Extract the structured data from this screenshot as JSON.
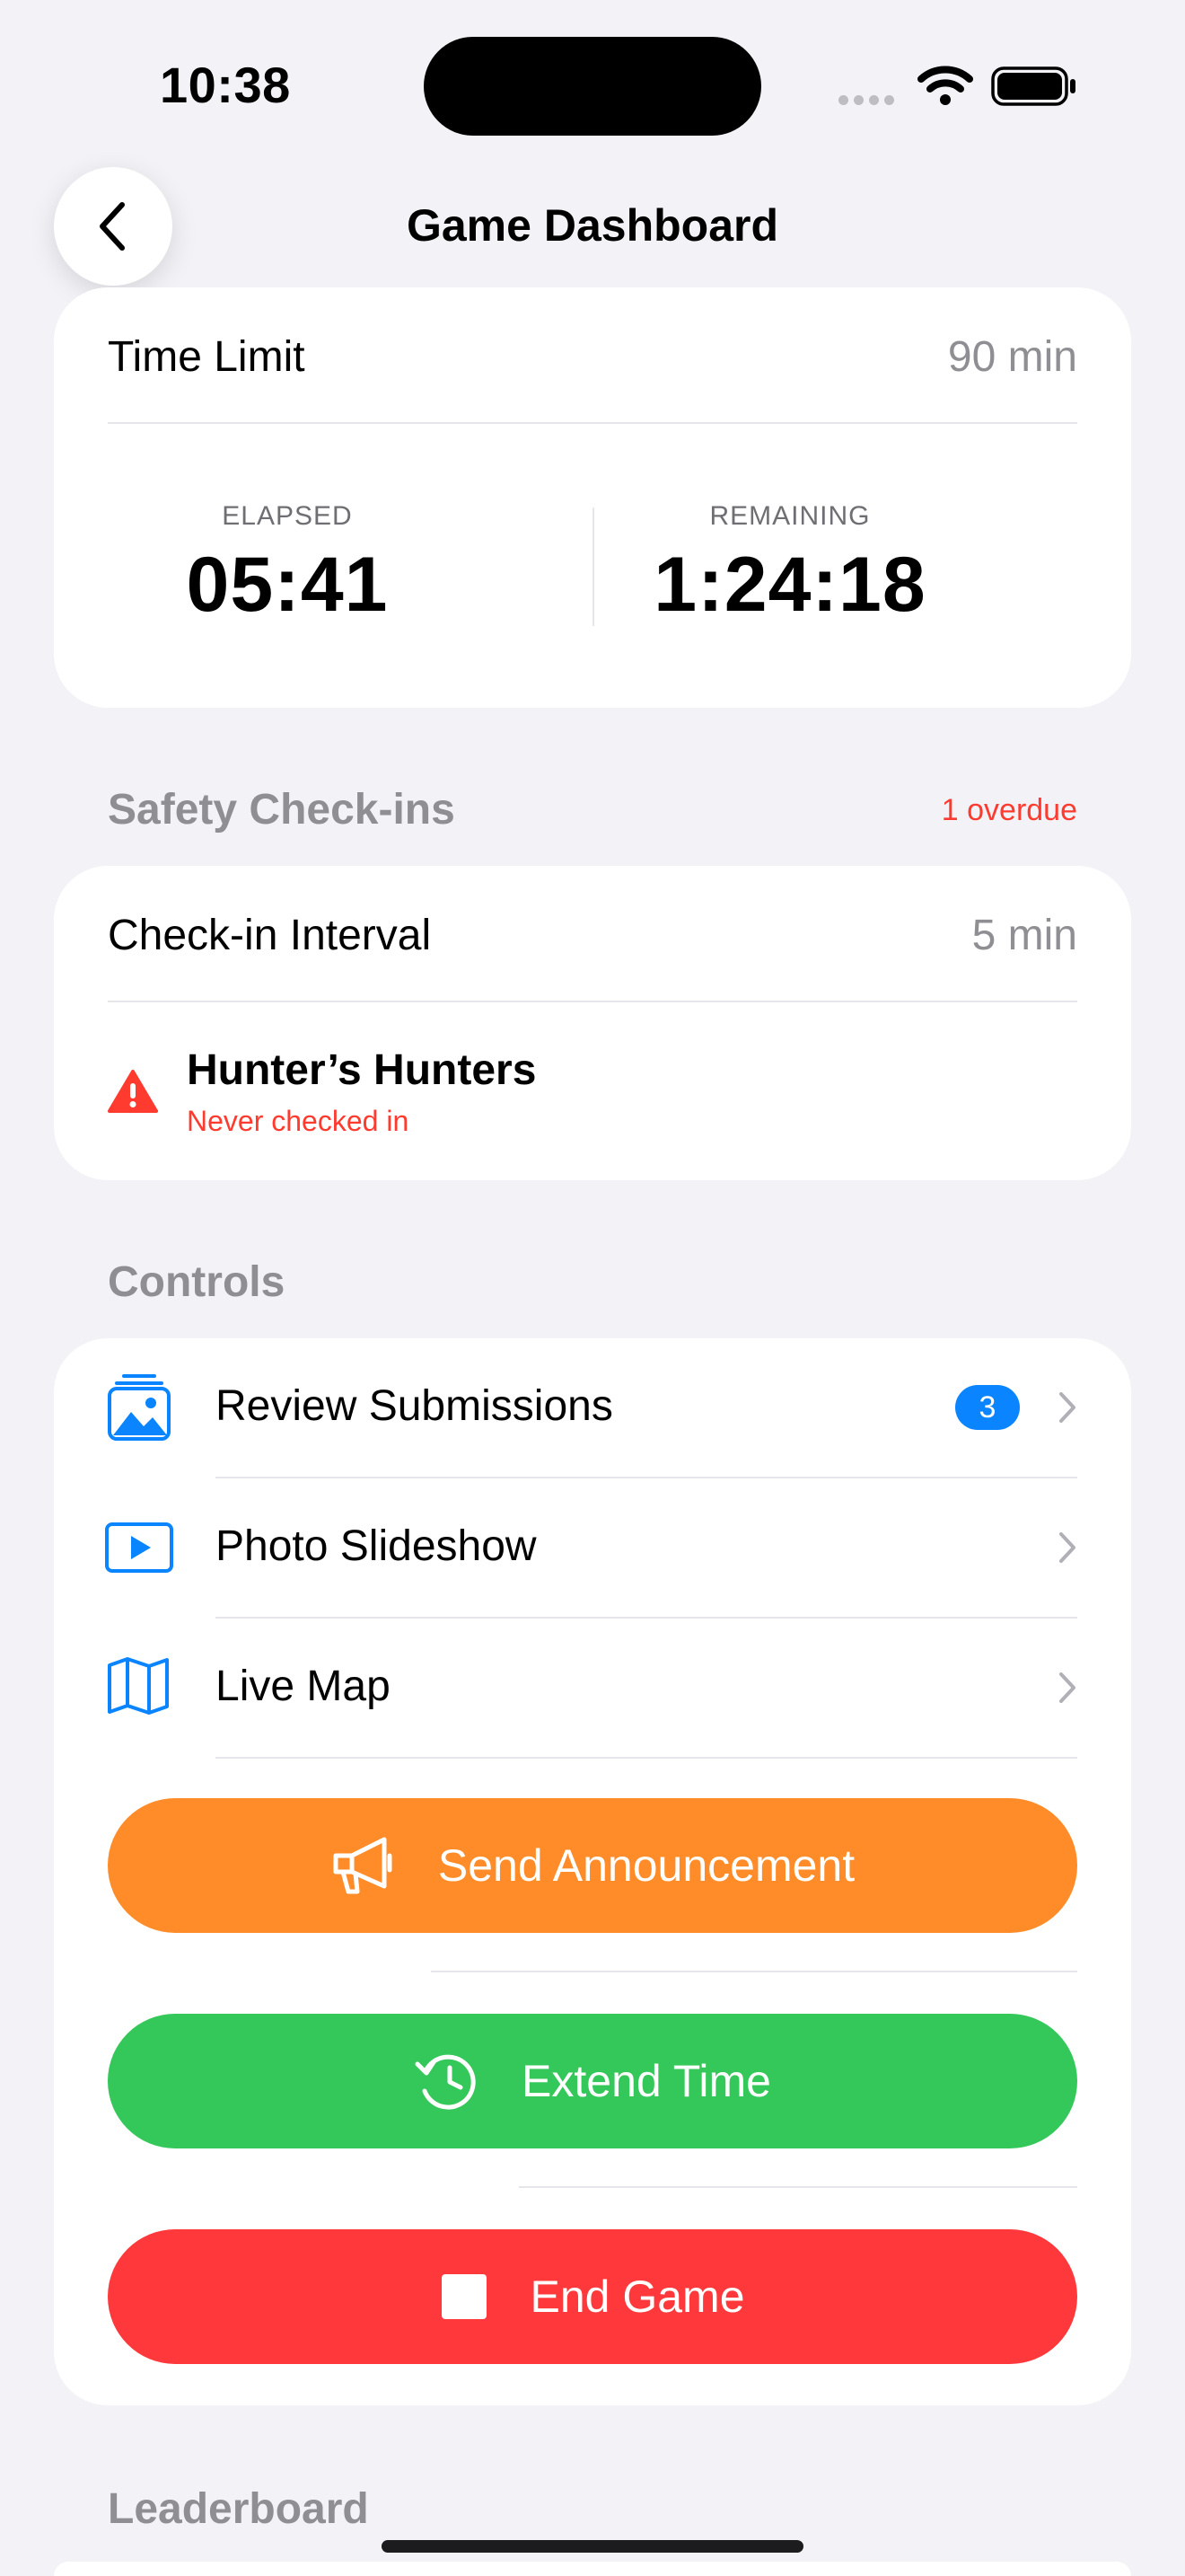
{
  "status_bar": {
    "time": "10:38"
  },
  "nav": {
    "title": "Game Dashboard"
  },
  "time_card": {
    "time_limit_label": "Time Limit",
    "time_limit_value": "90 min",
    "elapsed_label": "ELAPSED",
    "elapsed_value": "05:41",
    "remaining_label": "REMAINING",
    "remaining_value": "1:24:18"
  },
  "safety": {
    "header": "Safety Check-ins",
    "overdue": "1 overdue",
    "interval_label": "Check-in Interval",
    "interval_value": "5 min",
    "team_name": "Hunter’s Hunters",
    "team_status": "Never checked in"
  },
  "controls": {
    "header": "Controls",
    "items": [
      {
        "label": "Review Submissions",
        "badge": "3"
      },
      {
        "label": "Photo Slideshow"
      },
      {
        "label": "Live Map"
      }
    ],
    "announcement_label": "Send Announcement",
    "extend_label": "Extend Time",
    "end_label": "End Game"
  },
  "leaderboard": {
    "header": "Leaderboard"
  },
  "colors": {
    "accent_blue": "#0A84FF",
    "warning_red": "#FF3B30",
    "announcement_orange": "#FF8C28",
    "extend_green": "#34C759",
    "end_red": "#FF383C"
  }
}
